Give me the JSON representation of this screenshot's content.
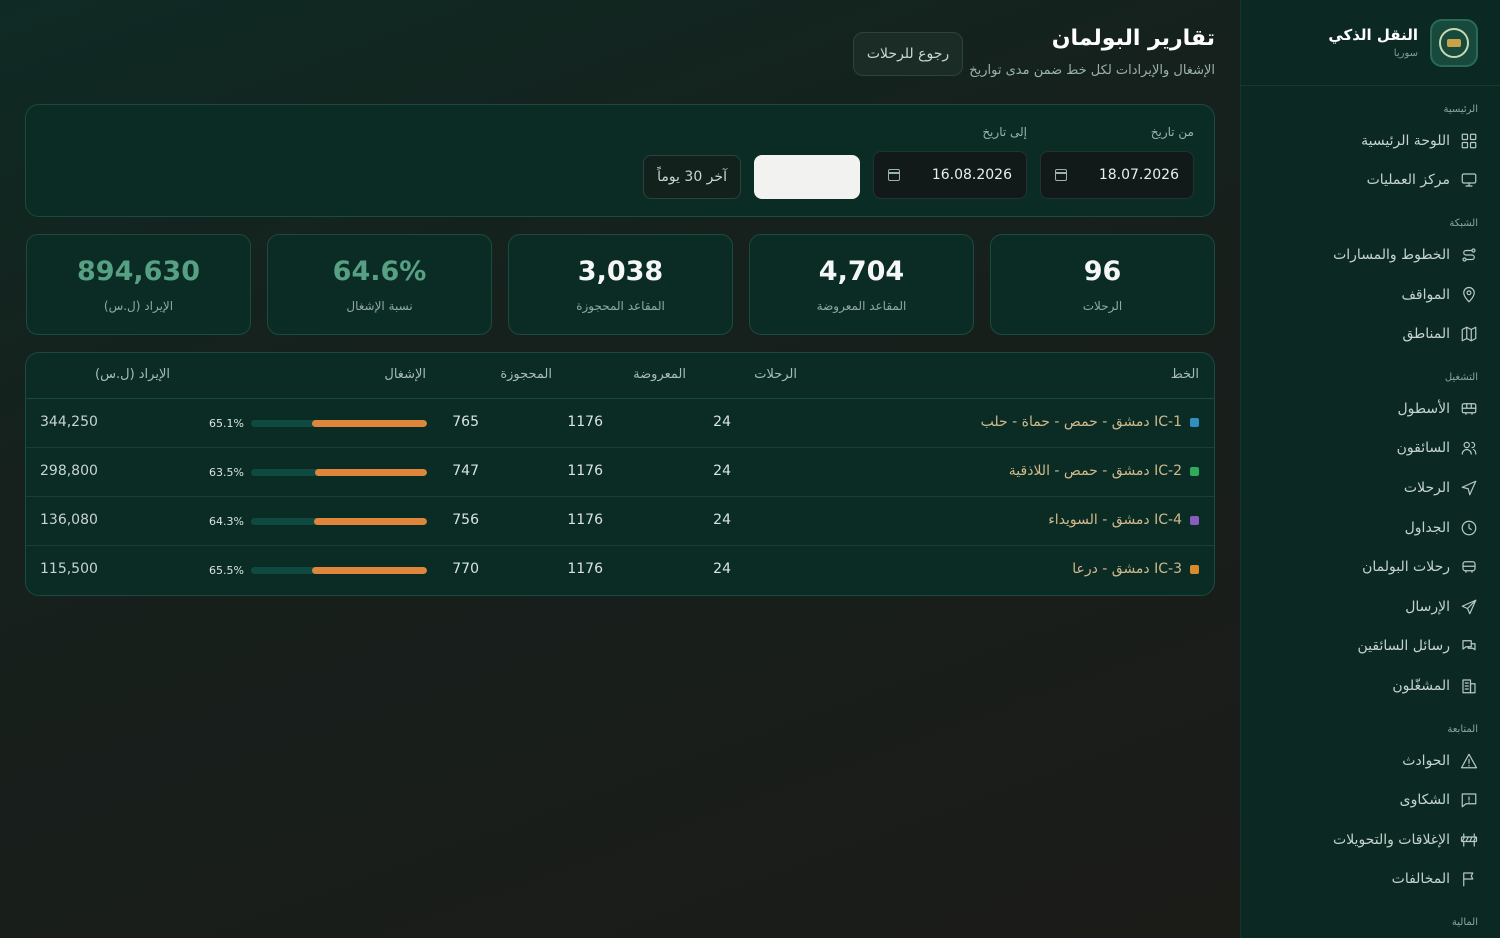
{
  "brand": {
    "title": "النقل الذكي",
    "subtitle": "سوريا"
  },
  "sidebar": [
    {
      "section": "الرئيسية",
      "items": [
        {
          "label": "اللوحة الرئيسية",
          "icon": "grid-icon"
        },
        {
          "label": "مركز العمليات",
          "icon": "monitor-icon"
        }
      ]
    },
    {
      "section": "الشبكة",
      "items": [
        {
          "label": "الخطوط والمسارات",
          "icon": "route-icon"
        },
        {
          "label": "المواقف",
          "icon": "map-pin-icon"
        },
        {
          "label": "المناطق",
          "icon": "map-icon"
        }
      ]
    },
    {
      "section": "التشغيل",
      "items": [
        {
          "label": "الأسطول",
          "icon": "bus-icon"
        },
        {
          "label": "السائقون",
          "icon": "users-icon"
        },
        {
          "label": "الرحلات",
          "icon": "navigation-icon"
        },
        {
          "label": "الجداول",
          "icon": "clock-icon"
        },
        {
          "label": "رحلات البولمان",
          "icon": "coach-icon"
        },
        {
          "label": "الإرسال",
          "icon": "send-icon"
        },
        {
          "label": "رسائل السائقين",
          "icon": "chat-icon"
        },
        {
          "label": "المشغّلون",
          "icon": "building-icon"
        }
      ]
    },
    {
      "section": "المتابعة",
      "items": [
        {
          "label": "الحوادث",
          "icon": "alert-triangle-icon"
        },
        {
          "label": "الشكاوى",
          "icon": "message-alert-icon"
        },
        {
          "label": "الإغلاقات والتحويلات",
          "icon": "barrier-icon"
        },
        {
          "label": "المخالفات",
          "icon": "flag-icon"
        }
      ]
    },
    {
      "section": "المالية",
      "items": []
    }
  ],
  "header": {
    "title": "تقارير البولمان",
    "subtitle": "الإشغال والإيرادات لكل خط ضمن مدى تواريخ",
    "back_label": "رجوع للرحلات"
  },
  "filters": {
    "from_label": "من تاريخ",
    "from_value": "18.07.2026",
    "to_label": "إلى تاريخ",
    "to_value": "16.08.2026",
    "range_label": "آخر 30 يوماً"
  },
  "stats": [
    {
      "value": "96",
      "label": "الرحلات"
    },
    {
      "value": "4,704",
      "label": "المقاعد المعروضة"
    },
    {
      "value": "3,038",
      "label": "المقاعد المحجوزة"
    },
    {
      "value": "64.6%",
      "label": "نسبة الإشغال"
    },
    {
      "value": "894,630",
      "label": "الإيراد (ل.س)"
    }
  ],
  "table": {
    "headers": {
      "line": "الخط",
      "trips": "الرحلات",
      "offered": "المعروضة",
      "booked": "المحجوزة",
      "occupancy": "الإشغال",
      "revenue": "الإيراد (ل.س)"
    },
    "rows": [
      {
        "line": "IC-1 دمشق - حمص - حماة - حلب",
        "color": "#2f8fc0",
        "trips": "24",
        "offered": "1176",
        "booked": "765",
        "occupancy": "65.1%",
        "occupancy_value": 65.1,
        "revenue": "344,250"
      },
      {
        "line": "IC-2 دمشق - حمص - اللاذقية",
        "color": "#2faa5a",
        "trips": "24",
        "offered": "1176",
        "booked": "747",
        "occupancy": "63.5%",
        "occupancy_value": 63.5,
        "revenue": "298,800"
      },
      {
        "line": "IC-4 دمشق - السويداء",
        "color": "#8a5cc0",
        "trips": "24",
        "offered": "1176",
        "booked": "756",
        "occupancy": "64.3%",
        "occupancy_value": 64.3,
        "revenue": "136,080"
      },
      {
        "line": "IC-3 دمشق - درعا",
        "color": "#d98a2b",
        "trips": "24",
        "offered": "1176",
        "booked": "770",
        "occupancy": "65.5%",
        "occupancy_value": 65.5,
        "revenue": "115,500"
      }
    ]
  },
  "colors": {
    "accent": "#e0863b",
    "panel": "#0a2c25",
    "muted_value": "#58a083"
  }
}
